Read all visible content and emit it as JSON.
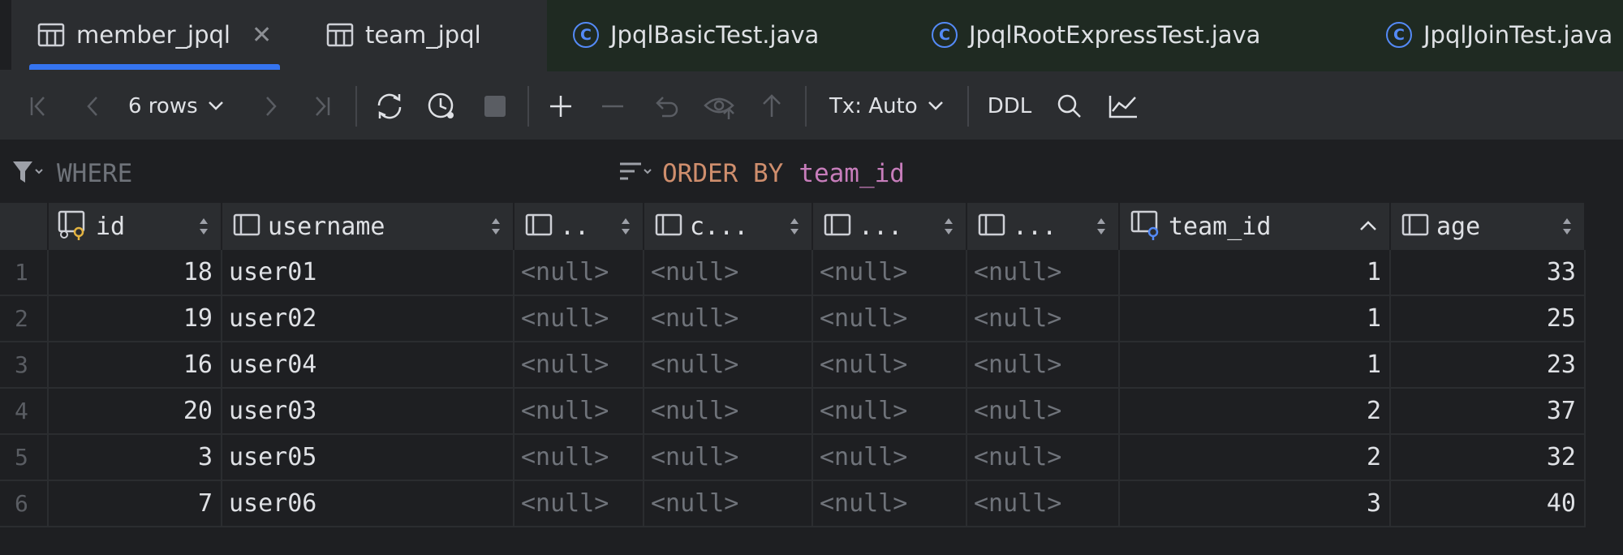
{
  "tabs": [
    {
      "label": "member_jpql",
      "icon": "table-icon",
      "active": true,
      "closable": true
    },
    {
      "label": "team_jpql",
      "icon": "table-icon",
      "active": false
    },
    {
      "label": "JpqlBasicTest.java",
      "icon": "java-class-icon",
      "active": false
    },
    {
      "label": "JpqlRootExpressTest.java",
      "icon": "java-class-icon",
      "active": false
    },
    {
      "label": "JpqlJoinTest.java",
      "icon": "java-class-icon",
      "active": false
    }
  ],
  "toolbar": {
    "rows_label": "6 rows",
    "tx_label": "Tx: Auto",
    "ddl_label": "DDL"
  },
  "filter": {
    "where_label": "WHERE",
    "order_keyword": "ORDER BY",
    "order_column": "team_id"
  },
  "grid": {
    "columns": [
      {
        "label": "id",
        "icon": "primary-key-column-icon",
        "sort": "none"
      },
      {
        "label": "username",
        "icon": "column-icon",
        "sort": "none"
      },
      {
        "label": "..",
        "icon": "column-icon",
        "sort": "none"
      },
      {
        "label": "c...",
        "icon": "column-icon",
        "sort": "none"
      },
      {
        "label": "...",
        "icon": "column-icon",
        "sort": "none"
      },
      {
        "label": "...",
        "icon": "column-icon",
        "sort": "none"
      },
      {
        "label": "team_id",
        "icon": "foreign-key-column-icon",
        "sort": "ascending"
      },
      {
        "label": "age",
        "icon": "column-icon",
        "sort": "none"
      }
    ],
    "rows": [
      {
        "num": "1",
        "cells": [
          "18",
          "user01",
          "<null>",
          "<null>",
          "<null>",
          "<null>",
          "1",
          "33"
        ]
      },
      {
        "num": "2",
        "cells": [
          "19",
          "user02",
          "<null>",
          "<null>",
          "<null>",
          "<null>",
          "1",
          "25"
        ]
      },
      {
        "num": "3",
        "cells": [
          "16",
          "user04",
          "<null>",
          "<null>",
          "<null>",
          "<null>",
          "1",
          "23"
        ]
      },
      {
        "num": "4",
        "cells": [
          "20",
          "user03",
          "<null>",
          "<null>",
          "<null>",
          "<null>",
          "2",
          "37"
        ]
      },
      {
        "num": "5",
        "cells": [
          "3",
          "user05",
          "<null>",
          "<null>",
          "<null>",
          "<null>",
          "2",
          "32"
        ]
      },
      {
        "num": "6",
        "cells": [
          "7",
          "user06",
          "<null>",
          "<null>",
          "<null>",
          "<null>",
          "3",
          "40"
        ]
      }
    ]
  },
  "colors": {
    "background": "#1e1f22",
    "panel": "#2b2d30",
    "accent": "#3574f0",
    "null_text": "#6f737a",
    "keyword": "#cf8e6d",
    "column_ref": "#c77dbb"
  }
}
